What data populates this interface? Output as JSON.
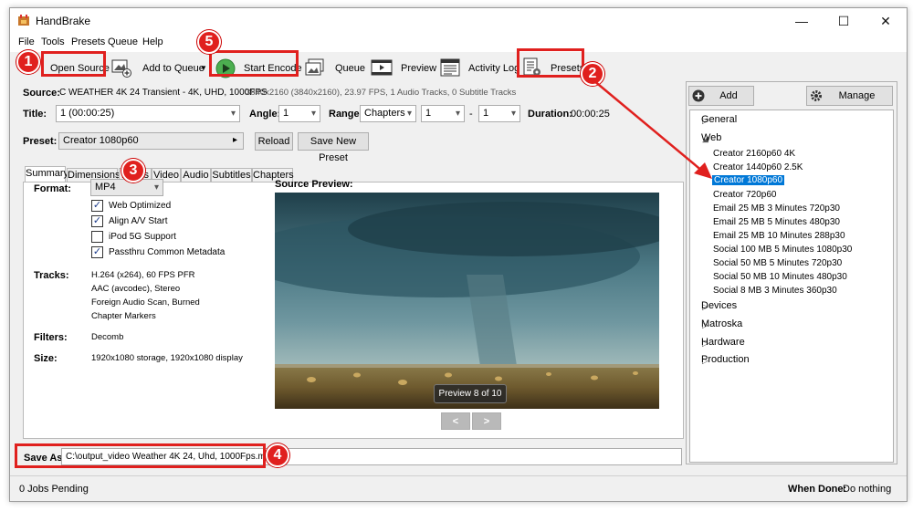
{
  "window": {
    "title": "HandBrake",
    "minimize": "—",
    "maximize": "☐",
    "close": "✕"
  },
  "menu": [
    "File",
    "Tools",
    "Presets",
    "Queue",
    "Help"
  ],
  "toolbar": {
    "open_source": "Open Source",
    "add_to_queue": "Add to Queue",
    "start_encode": "Start Encode",
    "queue": "Queue",
    "preview": "Preview",
    "activity_log": "Activity Log",
    "presets": "Presets"
  },
  "source": {
    "label": "Source:",
    "name": "C  WEATHER  4K 24  Transient - 4K, UHD, 1000FPS",
    "info": "3840x2160 (3840x2160), 23.97 FPS, 1 Audio Tracks, 0 Subtitle Tracks"
  },
  "title_row": {
    "title_label": "Title:",
    "title_value": "1 (00:00:25)",
    "angle_label": "Angle:",
    "angle_value": "1",
    "range_label": "Range:",
    "range_value": "Chapters",
    "range_start": "1",
    "range_sep": "-",
    "range_end": "1",
    "duration_label": "Duration:",
    "duration_value": "00:00:25"
  },
  "preset_row": {
    "label": "Preset:",
    "value": "Creator 1080p60",
    "arrow": "▸",
    "reload": "Reload",
    "save_new": "Save New Preset"
  },
  "tabs": [
    "Summary",
    "Dimensions",
    "Filters",
    "Video",
    "Audio",
    "Subtitles",
    "Chapters"
  ],
  "summary": {
    "format_label": "Format:",
    "format_value": "MP4",
    "options": [
      {
        "label": "Web Optimized",
        "checked": true
      },
      {
        "label": "Align A/V Start",
        "checked": true
      },
      {
        "label": "iPod 5G Support",
        "checked": false
      },
      {
        "label": "Passthru Common Metadata",
        "checked": true
      }
    ],
    "tracks_label": "Tracks:",
    "tracks": [
      "H.264 (x264), 60 FPS PFR",
      "AAC (avcodec), Stereo",
      "Foreign Audio Scan, Burned",
      "Chapter Markers"
    ],
    "filters_label": "Filters:",
    "filters_value": "Decomb",
    "size_label": "Size:",
    "size_value": "1920x1080 storage, 1920x1080 display"
  },
  "preview": {
    "label": "Source Preview:",
    "caption": "Preview 8 of 10",
    "prev": "<",
    "next": ">"
  },
  "save_as": {
    "label": "Save As:",
    "value": "C:\\output_video  Weather  4K 24, Uhd, 1000Fps.mp4"
  },
  "presets_panel": {
    "add": "Add Preset",
    "manage": "Manage Presets",
    "groups": [
      {
        "name": "General",
        "expanded": false
      },
      {
        "name": "Web",
        "expanded": true
      },
      {
        "name": "Devices",
        "expanded": false
      },
      {
        "name": "Matroska",
        "expanded": false
      },
      {
        "name": "Hardware",
        "expanded": false
      },
      {
        "name": "Production",
        "expanded": false
      }
    ],
    "web_items": [
      "Creator 2160p60 4K",
      "Creator 1440p60 2.5K",
      "Creator 1080p60",
      "Creator 720p60",
      "Email 25 MB 3 Minutes 720p30",
      "Email 25 MB 5 Minutes 480p30",
      "Email 25 MB 10 Minutes 288p30",
      "Social 100 MB 5 Minutes 1080p30",
      "Social 50 MB 5 Minutes 720p30",
      "Social 50 MB 10 Minutes 480p30",
      "Social 8 MB 3 Minutes 360p30"
    ],
    "selected": "Creator 1080p60"
  },
  "status": {
    "jobs": "0 Jobs Pending",
    "when_done_label": "When Done:",
    "when_done_value": "Do nothing"
  },
  "annotations": [
    "1",
    "2",
    "3",
    "4",
    "5"
  ],
  "colors": {
    "annotation_red": "#e0201e",
    "selection_blue": "#0078d7",
    "window_bg": "#f0f0f0"
  }
}
